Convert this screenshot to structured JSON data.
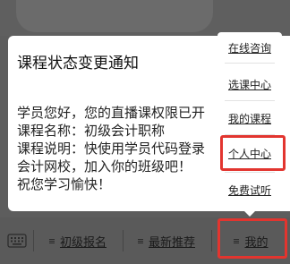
{
  "notification": {
    "title": "课程状态变更通知",
    "lines": [
      "学员您好，您的直播课权限已开",
      "课程名称：初级会计职称",
      "课程说明：快使用学员代码登录",
      "会计网校，加入你的班级吧！",
      "祝您学习愉快！"
    ]
  },
  "popup_menu": {
    "items": [
      {
        "label": "在线咨询"
      },
      {
        "label": "选课中心"
      },
      {
        "label": "我的课程"
      },
      {
        "label": "个人中心"
      },
      {
        "label": "免费试听"
      }
    ]
  },
  "bottom_nav": {
    "items": [
      {
        "label": "初级报名"
      },
      {
        "label": "最新推荐"
      },
      {
        "label": "我的"
      }
    ]
  },
  "colors": {
    "highlight": "#e2352f",
    "navbar_bg": "#5a5a5a",
    "overlay_bg": "#5d5d5d"
  },
  "icons": {
    "keyboard": "keyboard-icon",
    "menu": "menu-lines-icon"
  }
}
